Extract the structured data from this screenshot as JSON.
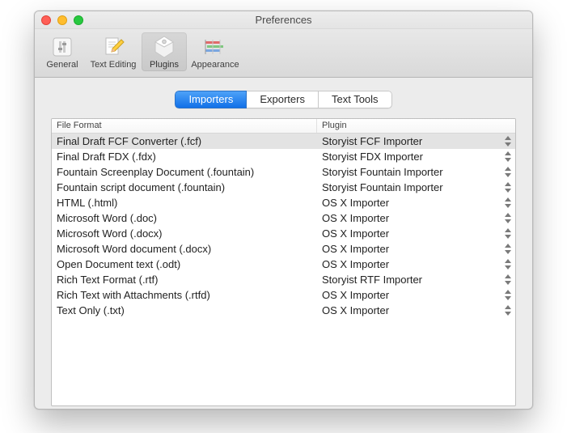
{
  "window": {
    "title": "Preferences"
  },
  "toolbar": {
    "items": [
      {
        "id": "general",
        "label": "General"
      },
      {
        "id": "text-editing",
        "label": "Text Editing"
      },
      {
        "id": "plugins",
        "label": "Plugins"
      },
      {
        "id": "appearance",
        "label": "Appearance"
      }
    ],
    "selected": "plugins"
  },
  "tabs": {
    "items": [
      {
        "id": "importers",
        "label": "Importers"
      },
      {
        "id": "exporters",
        "label": "Exporters"
      },
      {
        "id": "text-tools",
        "label": "Text Tools"
      }
    ],
    "selected": "importers"
  },
  "columns": {
    "format": "File Format",
    "plugin": "Plugin"
  },
  "rows": [
    {
      "format": "Final Draft FCF Converter (.fcf)",
      "plugin": "Storyist FCF Importer",
      "selected": true
    },
    {
      "format": "Final Draft FDX (.fdx)",
      "plugin": "Storyist FDX Importer"
    },
    {
      "format": "Fountain Screenplay Document (.fountain)",
      "plugin": "Storyist Fountain Importer"
    },
    {
      "format": "Fountain script document (.fountain)",
      "plugin": "Storyist Fountain Importer"
    },
    {
      "format": "HTML (.html)",
      "plugin": "OS X Importer"
    },
    {
      "format": "Microsoft Word (.doc)",
      "plugin": "OS X Importer"
    },
    {
      "format": "Microsoft Word (.docx)",
      "plugin": "OS X Importer"
    },
    {
      "format": "Microsoft Word document (.docx)",
      "plugin": "OS X Importer"
    },
    {
      "format": "Open Document text (.odt)",
      "plugin": "OS X Importer"
    },
    {
      "format": "Rich Text Format (.rtf)",
      "plugin": "Storyist RTF Importer"
    },
    {
      "format": "Rich Text with Attachments (.rtfd)",
      "plugin": "OS X Importer"
    },
    {
      "format": "Text Only (.txt)",
      "plugin": "OS X Importer"
    }
  ]
}
